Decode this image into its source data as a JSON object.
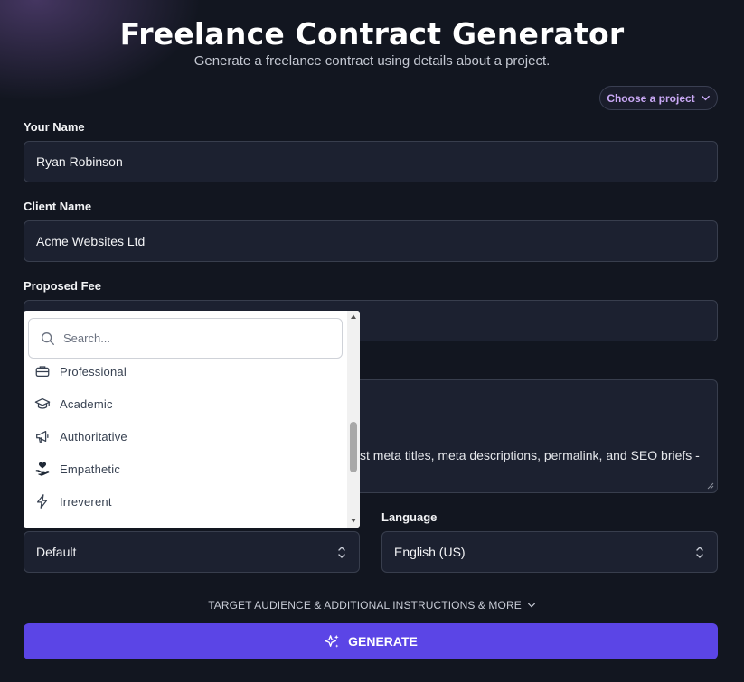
{
  "header": {
    "title": "Freelance Contract Generator",
    "subtitle": "Generate a freelance contract using details about a project."
  },
  "project_picker": {
    "label": "Choose a project",
    "icon": "chevron-down-icon"
  },
  "form": {
    "your_name": {
      "label": "Your Name",
      "value": "Ryan Robinson"
    },
    "client_name": {
      "label": "Client Name",
      "value": "Acme Websites Ltd"
    },
    "proposed_fee": {
      "label": "Proposed Fee",
      "value": ""
    },
    "description_visible_text": "st meta titles, meta descriptions, permalink, and SEO briefs -",
    "tone": {
      "value": "Default"
    },
    "language": {
      "label": "Language",
      "value": "English (US)"
    }
  },
  "more_options": {
    "label": "TARGET AUDIENCE & ADDITIONAL INSTRUCTIONS & MORE"
  },
  "generate": {
    "label": "GENERATE",
    "icon": "sparkles-icon"
  },
  "tone_dropdown": {
    "search_placeholder": "Search...",
    "items": [
      {
        "label": "Professional",
        "icon": "briefcase-icon"
      },
      {
        "label": "Academic",
        "icon": "graduation-cap-icon"
      },
      {
        "label": "Authoritative",
        "icon": "megaphone-icon"
      },
      {
        "label": "Empathetic",
        "icon": "hand-heart-icon"
      },
      {
        "label": "Irreverent",
        "icon": "lightning-icon"
      }
    ]
  },
  "colors": {
    "background": "#121620",
    "field": "#1c2130",
    "accent": "#5b45e6",
    "picker_text": "#c9a8f5"
  }
}
